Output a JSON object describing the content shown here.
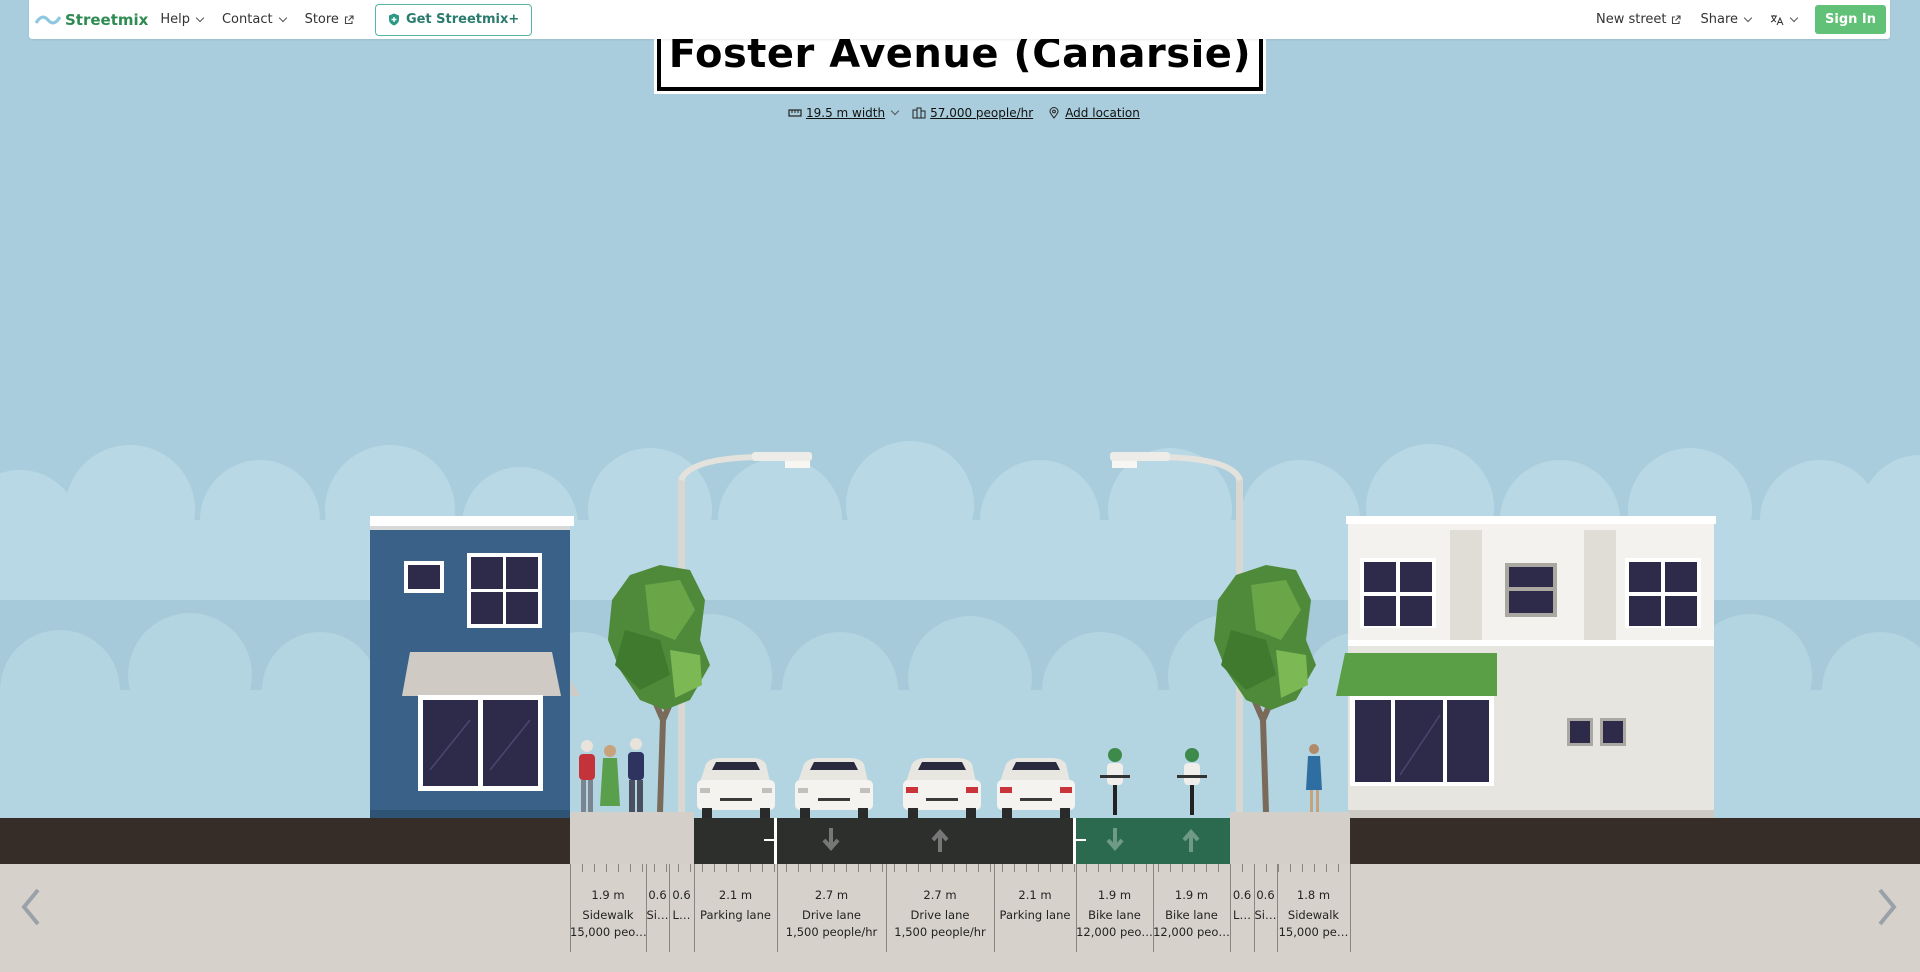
{
  "app": {
    "brand": "Streetmix",
    "nav_left": [
      {
        "label": "Help",
        "dropdown": true
      },
      {
        "label": "Contact",
        "dropdown": true
      },
      {
        "label": "Store",
        "external": true
      }
    ],
    "plus_button": "Get Streetmix+",
    "nav_right": [
      {
        "label": "New street",
        "external": true
      },
      {
        "label": "Share",
        "dropdown": true
      }
    ],
    "language_icon": "translate-icon",
    "sign_in": "Sign In",
    "colors": {
      "brand_green": "#2e8b52",
      "sign_in_bg": "#61c177",
      "plus_border": "#5ab3a3"
    }
  },
  "street": {
    "name": "Foster Avenue (Canarsie)",
    "width": "19.5 m width",
    "capacity": "57,000 people/hr",
    "location": "Add location"
  },
  "segments": [
    {
      "width": "1.9 m",
      "name": "Sidewalk",
      "capacity": "15,000 peo…"
    },
    {
      "width": "0.6",
      "name": "Si…",
      "capacity": ""
    },
    {
      "width": "0.6",
      "name": "L…",
      "capacity": ""
    },
    {
      "width": "2.1 m",
      "name": "Parking lane",
      "capacity": ""
    },
    {
      "width": "2.7 m",
      "name": "Drive lane",
      "capacity": "1,500 people/hr"
    },
    {
      "width": "2.7 m",
      "name": "Drive lane",
      "capacity": "1,500 people/hr"
    },
    {
      "width": "2.1 m",
      "name": "Parking lane",
      "capacity": ""
    },
    {
      "width": "1.9 m",
      "name": "Bike lane",
      "capacity": "12,000 peo…"
    },
    {
      "width": "1.9 m",
      "name": "Bike lane",
      "capacity": "12,000 peo…"
    },
    {
      "width": "0.6",
      "name": "L…",
      "capacity": ""
    },
    {
      "width": "0.6",
      "name": "Si…",
      "capacity": ""
    },
    {
      "width": "1.8 m",
      "name": "Sidewalk",
      "capacity": "15,000 pe…"
    }
  ],
  "colors": {
    "sky": "#a9cddc",
    "ground": "#362d29",
    "asphalt": "#2d2f2d",
    "bike_lane": "#2c6a4f",
    "sidewalk": "#d6d2cb"
  }
}
